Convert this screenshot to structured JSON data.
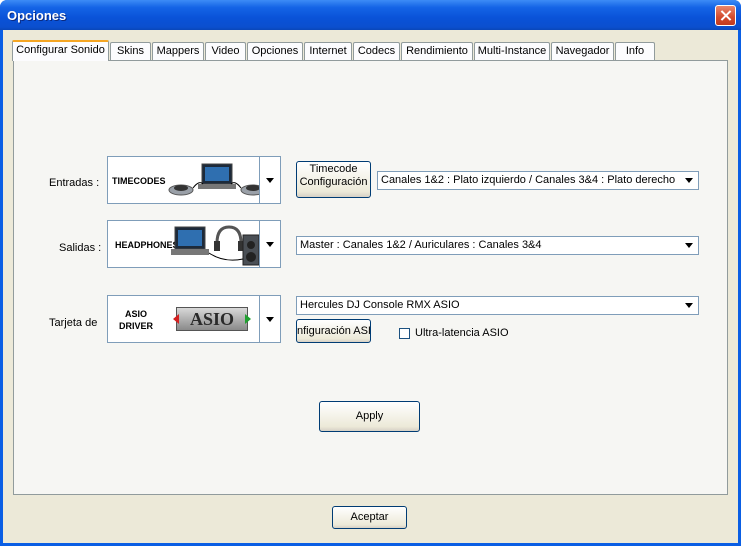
{
  "window": {
    "title": "Opciones"
  },
  "tabs": [
    {
      "label": "Configurar Sonido",
      "active": true
    },
    {
      "label": "Skins"
    },
    {
      "label": "Mappers"
    },
    {
      "label": "Video"
    },
    {
      "label": "Opciones"
    },
    {
      "label": "Internet"
    },
    {
      "label": "Codecs"
    },
    {
      "label": "Rendimiento"
    },
    {
      "label": "Multi-Instance"
    },
    {
      "label": "Navegador"
    },
    {
      "label": "Info"
    }
  ],
  "sound": {
    "inputs": {
      "label": "Entradas :",
      "image_caption": "TIMECODES",
      "config_button": "Timecode Configuración",
      "config_line1": "Timecode",
      "config_line2": "Configuración",
      "routing": "Canales 1&2 : Plato izquierdo / Canales 3&4 : Plato derecho"
    },
    "outputs": {
      "label": "Salidas :",
      "image_caption": "HEADPHONES",
      "routing": "Master : Canales 1&2 / Auriculares : Canales 3&4"
    },
    "card": {
      "label": "Tarjeta de",
      "image_caption_line1": "ASIO",
      "image_caption_line2": "DRIVER",
      "logo_text": "ASIO",
      "device": "Hercules DJ Console RMX ASIO",
      "config_button": "nfiguración ASI",
      "ultra_latency_label": "Ultra-latencia ASIO",
      "ultra_latency_checked": false
    },
    "apply_button": "Apply"
  },
  "footer": {
    "accept_button": "Aceptar"
  },
  "colors": {
    "titlebar": "#0a52d8",
    "dialog_bg": "#ece9d8",
    "tab_accent": "#f5a623",
    "close_red": "#d24a2d"
  }
}
